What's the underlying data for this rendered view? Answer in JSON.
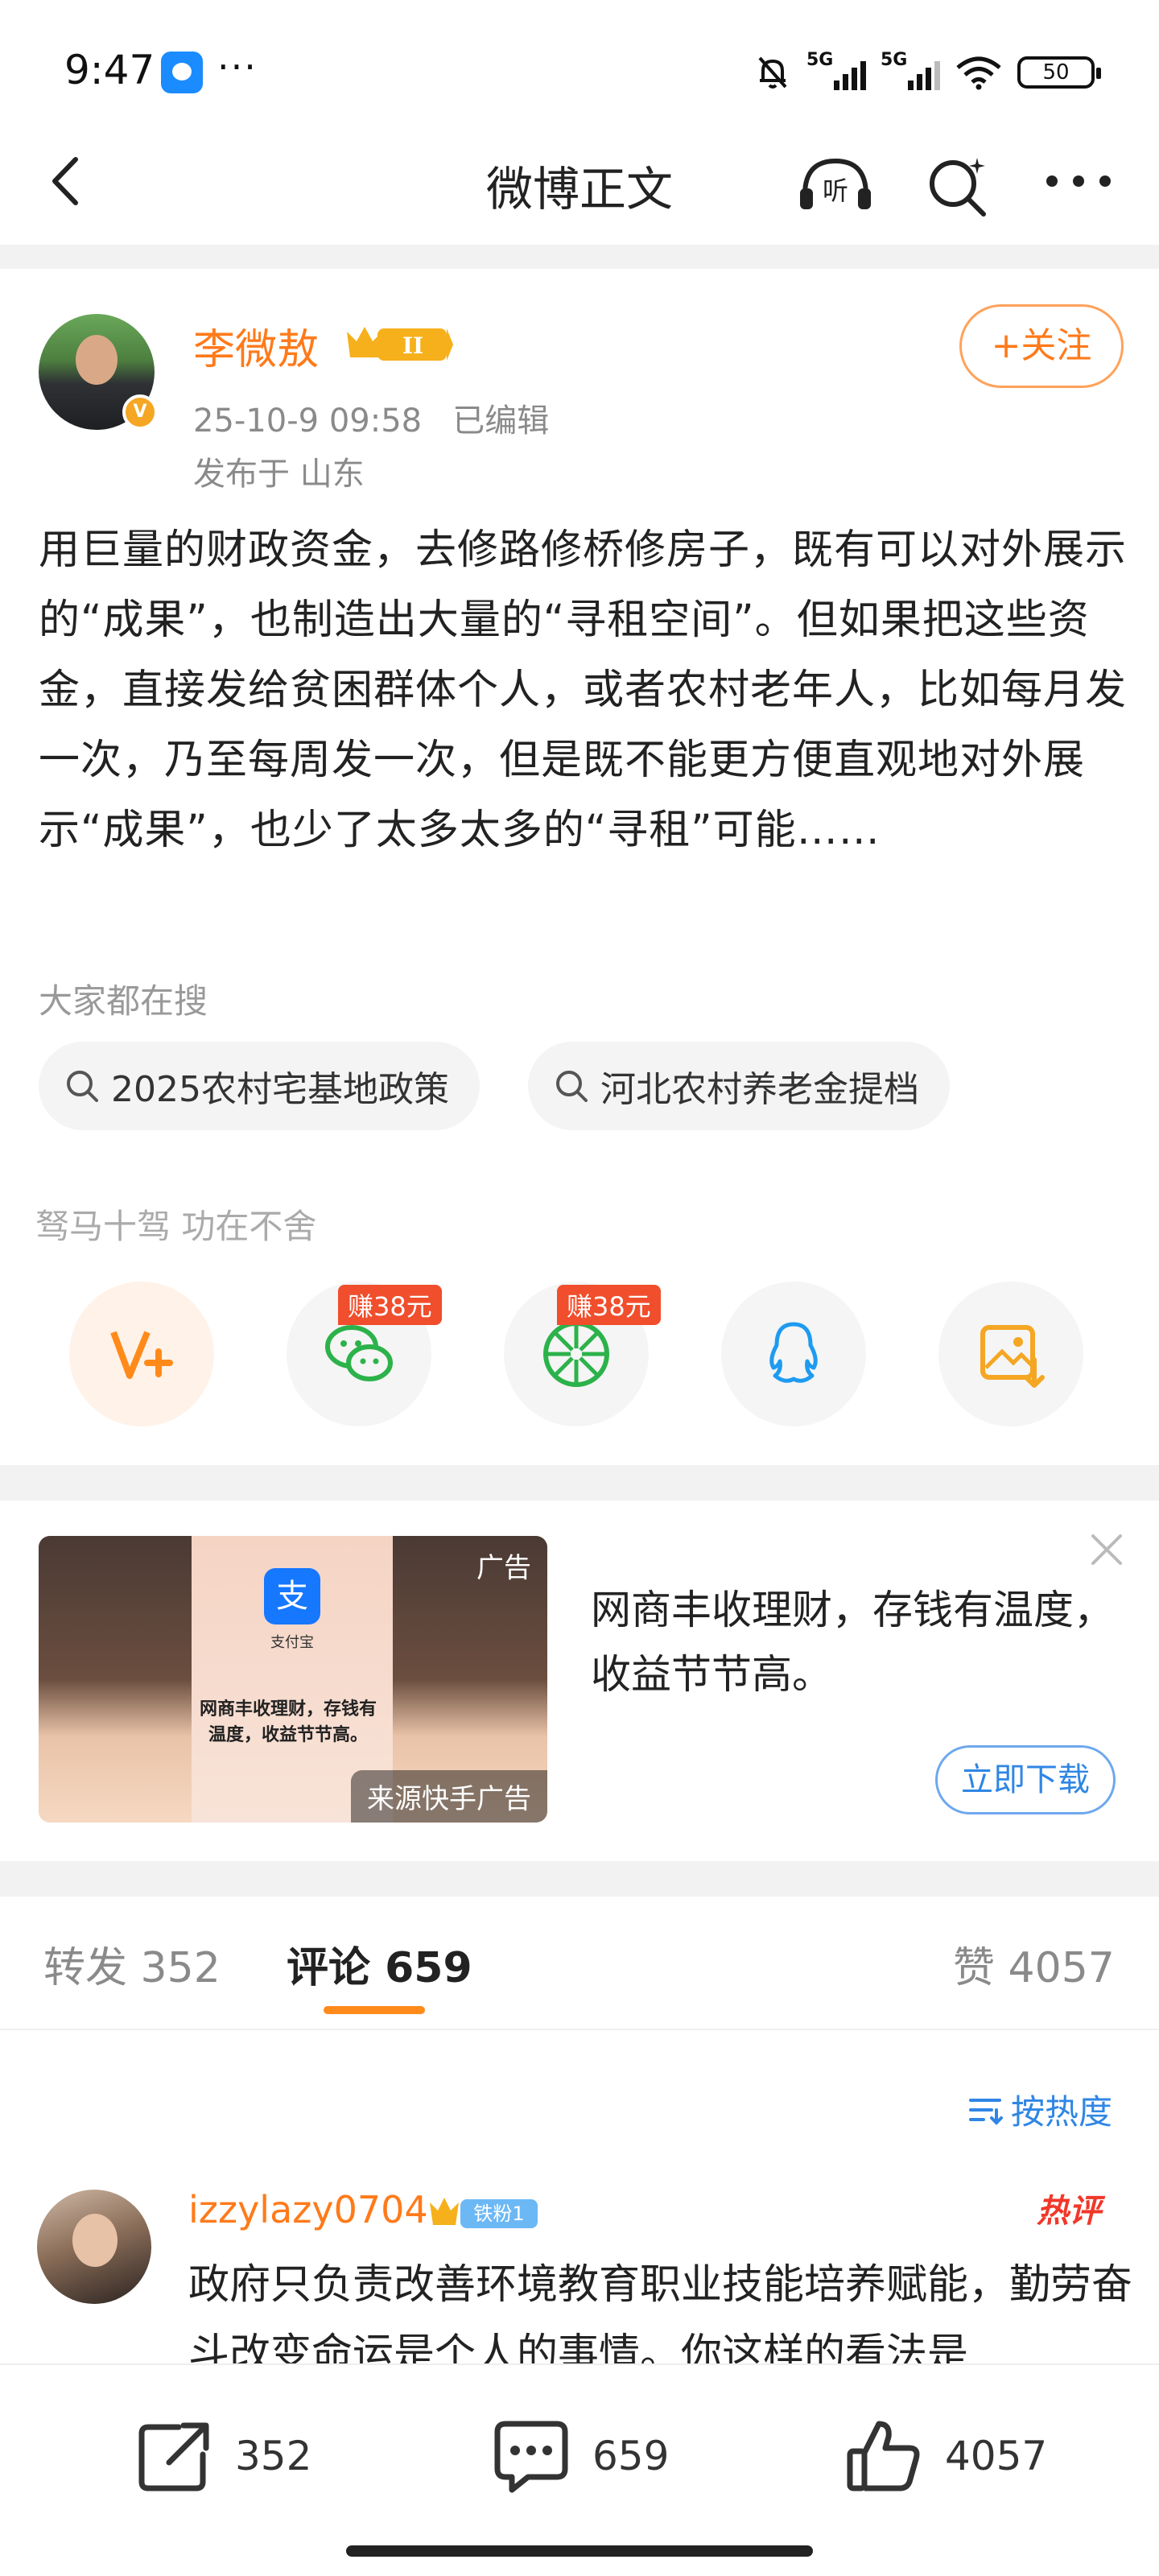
{
  "status_bar": {
    "time": "9:47",
    "network_1": "5G",
    "network_2": "5G",
    "battery": "50"
  },
  "nav": {
    "title": "微博正文",
    "listen_label": "听"
  },
  "post": {
    "author": "李微敖",
    "level_badge": "II",
    "verified_mark": "V",
    "meta": "25-10-9 09:58   已编辑",
    "location": "发布于 山东",
    "follow_label": "+关注",
    "body": "用巨量的财政资金，去修路修桥修房子，既有可以对外展示的“成果”，也制造出大量的“寻租空间”。但如果把这些资金，直接发给贫困群体个人，或者农村老年人，比如每月发一次，乃至每周发一次，但是既不能更方便直观地对外展示“成果”，也少了太多太多的“寻租”可能……"
  },
  "hot_search": {
    "label": "大家都在搜",
    "items": [
      "2025农村宅基地政策",
      "河北农村养老金提档"
    ]
  },
  "share": {
    "slogan": "驽马十驾 功在不舍",
    "earn_badge_1": "赚38元",
    "earn_badge_2": "赚38元",
    "icons": [
      "weibo-v-plus-icon",
      "wechat-icon",
      "moments-icon",
      "qq-icon",
      "save-image-icon"
    ]
  },
  "ad": {
    "tag": "广告",
    "source": "来源快手广告",
    "text": "网商丰收理财，存钱有温度，收益节节高。",
    "button": "立即下载",
    "image_caption": "网商丰收理财，存钱有温度，收益节节高。",
    "image_app_label": "支付宝"
  },
  "tabs": {
    "repost": "转发 352",
    "comment": "评论 659",
    "like": "赞 4057"
  },
  "sort_label": "按热度",
  "comments": [
    {
      "user": "izzylazy0704",
      "fan_badge": "铁粉1",
      "hot_tag": "热评",
      "text": "政府只负责改善环境教育职业技能培养赋能，勤劳奋斗改变命运是个人的事情。你这样的看法是"
    }
  ],
  "bottom_bar": {
    "repost_count": "352",
    "comment_count": "659",
    "like_count": "4057"
  },
  "colors": {
    "accent": "#ff7a1a",
    "link_blue": "#2f86e5",
    "hot_red": "#f0382a"
  }
}
